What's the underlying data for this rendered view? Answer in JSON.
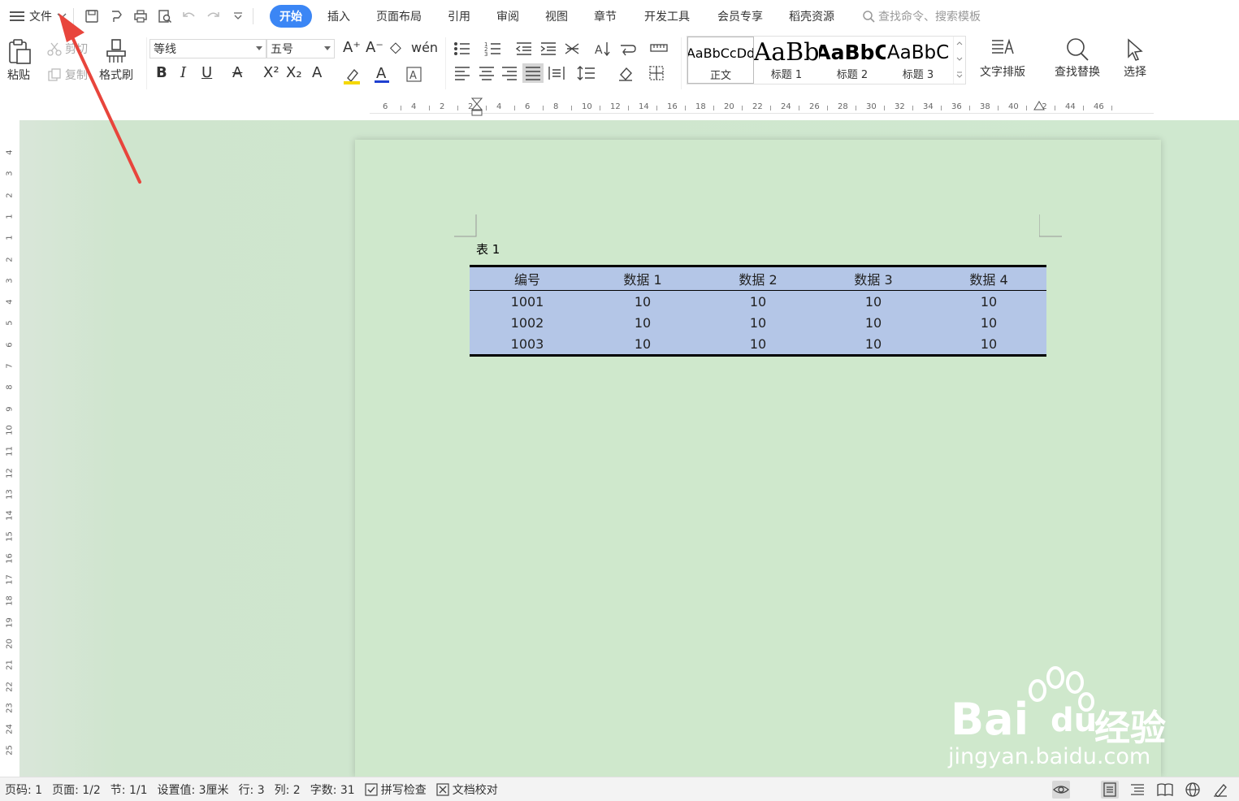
{
  "menubar": {
    "file_label": "文件",
    "tabs": [
      "开始",
      "插入",
      "页面布局",
      "引用",
      "审阅",
      "视图",
      "章节",
      "开发工具",
      "会员专享",
      "稻壳资源"
    ],
    "active_tab": "开始",
    "search_placeholder": "查找命令、搜索模板"
  },
  "ribbon": {
    "paste": "粘贴",
    "cut": "剪切",
    "copy": "复制",
    "format_painter": "格式刷",
    "font_name": "等线",
    "font_size": "五号",
    "styles": [
      {
        "preview": "AaBbCcDd",
        "name": "正文"
      },
      {
        "preview": "AaBb",
        "name": "标题 1"
      },
      {
        "preview": "AaBbC",
        "name": "标题 2"
      },
      {
        "preview": "AaBbC",
        "name": "标题 3"
      }
    ],
    "text_layout": "文字排版",
    "find_replace": "查找替换",
    "select": "选择",
    "bold": "B",
    "italic": "I",
    "underline": "U",
    "superscript": "X²",
    "subscript": "X₂"
  },
  "ruler": {
    "horizontal_ticks": [
      "6",
      "4",
      "2",
      "2",
      "4",
      "6",
      "8",
      "10",
      "12",
      "14",
      "16",
      "18",
      "20",
      "22",
      "24",
      "26",
      "28",
      "30",
      "32",
      "34",
      "36",
      "38",
      "40",
      "42",
      "44",
      "46"
    ],
    "vertical_ticks": [
      "4",
      "3",
      "2",
      "1",
      "1",
      "2",
      "3",
      "4",
      "5",
      "6",
      "7",
      "8",
      "9",
      "10",
      "11",
      "12",
      "13",
      "14",
      "15",
      "16",
      "17",
      "18",
      "19",
      "20",
      "21",
      "22",
      "23",
      "24",
      "25"
    ]
  },
  "document": {
    "caption": "表 1",
    "table": {
      "headers": [
        "编号",
        "数据 1",
        "数据 2",
        "数据 3",
        "数据 4"
      ],
      "rows": [
        [
          "1001",
          "10",
          "10",
          "10",
          "10"
        ],
        [
          "1002",
          "10",
          "10",
          "10",
          "10"
        ],
        [
          "1003",
          "10",
          "10",
          "10",
          "10"
        ]
      ]
    }
  },
  "statusbar": {
    "page_code": "页码: 1",
    "page": "页面: 1/2",
    "section": "节: 1/1",
    "setting": "设置值: 3厘米",
    "row": "行: 3",
    "col": "列: 2",
    "word_count": "字数: 31",
    "spell_check": "拼写检查",
    "doc_proof": "文档校对"
  },
  "watermark": {
    "brand": "Bai",
    "brand2": "du",
    "cn": "经验",
    "url": "jingyan.baidu.com"
  },
  "colors": {
    "accent": "#3b86f5",
    "page_bg": "#cfe8cc",
    "table_fill": "#b4c6e7",
    "annotation_arrow": "#e8453c"
  }
}
